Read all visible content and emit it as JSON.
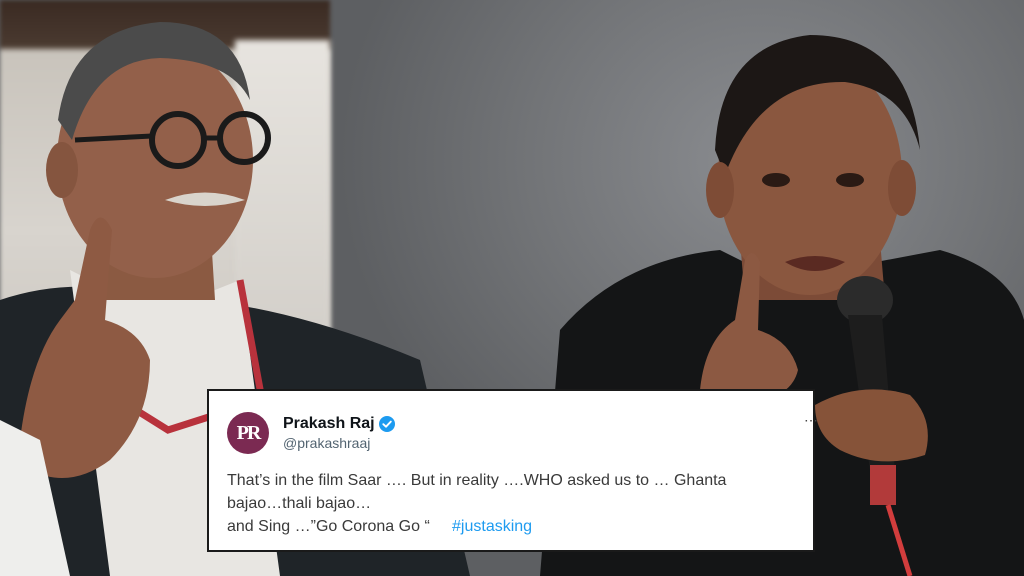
{
  "tweet": {
    "display_name": "Prakash Raj",
    "handle": "@prakashraaj",
    "avatar_initials": "PR",
    "verified_icon": "verified-badge-icon",
    "more_icon": "ellipsis-icon",
    "text_lines": [
      "That’s in the film Saar …. But in reality  ….WHO  asked us to … Ghanta",
      "bajao…thali bajao…",
      "and Sing …”Go Corona Go “"
    ],
    "hashtag": "#justasking",
    "colors": {
      "hashtag": "#1d9bf0",
      "verified": "#1d9bf0",
      "avatar_bg": "#7b2a52"
    }
  }
}
